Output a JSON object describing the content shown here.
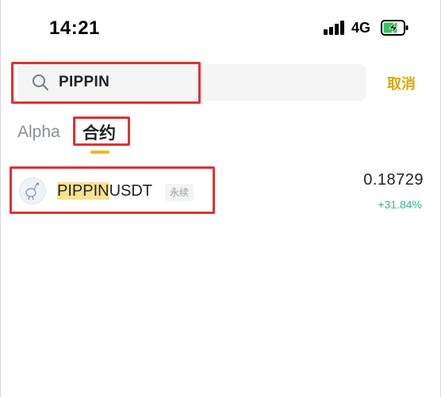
{
  "status_bar": {
    "time": "14:21",
    "network": "4G"
  },
  "search": {
    "value": "PIPPIN",
    "icon": "search-icon",
    "cancel_label": "取消"
  },
  "tabs": [
    {
      "label": "Alpha",
      "active": false
    },
    {
      "label": "合约",
      "active": true
    }
  ],
  "results": [
    {
      "symbol_highlight": "PIPPIN",
      "symbol_rest": "USDT",
      "badge": "永续",
      "price": "0.18729",
      "change": "+31.84%",
      "change_color": "#2ebd85"
    }
  ],
  "colors": {
    "accent": "#f0b90b",
    "cancel": "#d9a800",
    "positive": "#2ebd85",
    "highlight": "#f7e38f",
    "annotation": "#e03131"
  }
}
